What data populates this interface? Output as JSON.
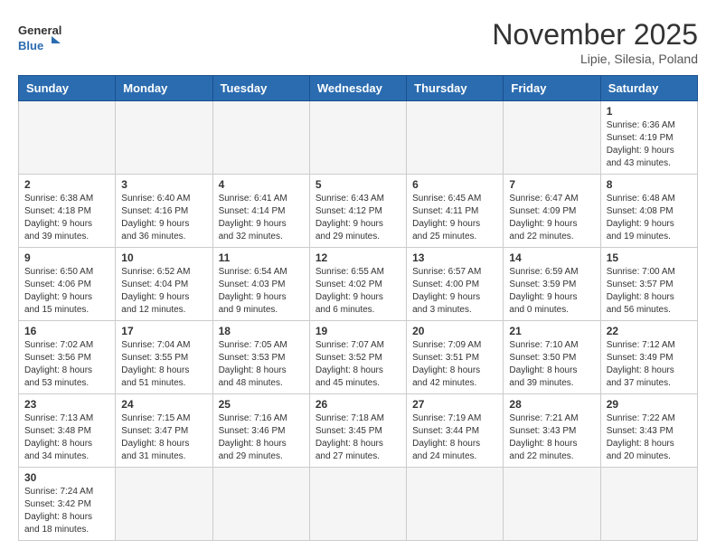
{
  "logo": {
    "text_general": "General",
    "text_blue": "Blue"
  },
  "title": "November 2025",
  "location": "Lipie, Silesia, Poland",
  "weekdays": [
    "Sunday",
    "Monday",
    "Tuesday",
    "Wednesday",
    "Thursday",
    "Friday",
    "Saturday"
  ],
  "weeks": [
    [
      {
        "day": "",
        "info": ""
      },
      {
        "day": "",
        "info": ""
      },
      {
        "day": "",
        "info": ""
      },
      {
        "day": "",
        "info": ""
      },
      {
        "day": "",
        "info": ""
      },
      {
        "day": "",
        "info": ""
      },
      {
        "day": "1",
        "info": "Sunrise: 6:36 AM\nSunset: 4:19 PM\nDaylight: 9 hours and 43 minutes."
      }
    ],
    [
      {
        "day": "2",
        "info": "Sunrise: 6:38 AM\nSunset: 4:18 PM\nDaylight: 9 hours and 39 minutes."
      },
      {
        "day": "3",
        "info": "Sunrise: 6:40 AM\nSunset: 4:16 PM\nDaylight: 9 hours and 36 minutes."
      },
      {
        "day": "4",
        "info": "Sunrise: 6:41 AM\nSunset: 4:14 PM\nDaylight: 9 hours and 32 minutes."
      },
      {
        "day": "5",
        "info": "Sunrise: 6:43 AM\nSunset: 4:12 PM\nDaylight: 9 hours and 29 minutes."
      },
      {
        "day": "6",
        "info": "Sunrise: 6:45 AM\nSunset: 4:11 PM\nDaylight: 9 hours and 25 minutes."
      },
      {
        "day": "7",
        "info": "Sunrise: 6:47 AM\nSunset: 4:09 PM\nDaylight: 9 hours and 22 minutes."
      },
      {
        "day": "8",
        "info": "Sunrise: 6:48 AM\nSunset: 4:08 PM\nDaylight: 9 hours and 19 minutes."
      }
    ],
    [
      {
        "day": "9",
        "info": "Sunrise: 6:50 AM\nSunset: 4:06 PM\nDaylight: 9 hours and 15 minutes."
      },
      {
        "day": "10",
        "info": "Sunrise: 6:52 AM\nSunset: 4:04 PM\nDaylight: 9 hours and 12 minutes."
      },
      {
        "day": "11",
        "info": "Sunrise: 6:54 AM\nSunset: 4:03 PM\nDaylight: 9 hours and 9 minutes."
      },
      {
        "day": "12",
        "info": "Sunrise: 6:55 AM\nSunset: 4:02 PM\nDaylight: 9 hours and 6 minutes."
      },
      {
        "day": "13",
        "info": "Sunrise: 6:57 AM\nSunset: 4:00 PM\nDaylight: 9 hours and 3 minutes."
      },
      {
        "day": "14",
        "info": "Sunrise: 6:59 AM\nSunset: 3:59 PM\nDaylight: 9 hours and 0 minutes."
      },
      {
        "day": "15",
        "info": "Sunrise: 7:00 AM\nSunset: 3:57 PM\nDaylight: 8 hours and 56 minutes."
      }
    ],
    [
      {
        "day": "16",
        "info": "Sunrise: 7:02 AM\nSunset: 3:56 PM\nDaylight: 8 hours and 53 minutes."
      },
      {
        "day": "17",
        "info": "Sunrise: 7:04 AM\nSunset: 3:55 PM\nDaylight: 8 hours and 51 minutes."
      },
      {
        "day": "18",
        "info": "Sunrise: 7:05 AM\nSunset: 3:53 PM\nDaylight: 8 hours and 48 minutes."
      },
      {
        "day": "19",
        "info": "Sunrise: 7:07 AM\nSunset: 3:52 PM\nDaylight: 8 hours and 45 minutes."
      },
      {
        "day": "20",
        "info": "Sunrise: 7:09 AM\nSunset: 3:51 PM\nDaylight: 8 hours and 42 minutes."
      },
      {
        "day": "21",
        "info": "Sunrise: 7:10 AM\nSunset: 3:50 PM\nDaylight: 8 hours and 39 minutes."
      },
      {
        "day": "22",
        "info": "Sunrise: 7:12 AM\nSunset: 3:49 PM\nDaylight: 8 hours and 37 minutes."
      }
    ],
    [
      {
        "day": "23",
        "info": "Sunrise: 7:13 AM\nSunset: 3:48 PM\nDaylight: 8 hours and 34 minutes."
      },
      {
        "day": "24",
        "info": "Sunrise: 7:15 AM\nSunset: 3:47 PM\nDaylight: 8 hours and 31 minutes."
      },
      {
        "day": "25",
        "info": "Sunrise: 7:16 AM\nSunset: 3:46 PM\nDaylight: 8 hours and 29 minutes."
      },
      {
        "day": "26",
        "info": "Sunrise: 7:18 AM\nSunset: 3:45 PM\nDaylight: 8 hours and 27 minutes."
      },
      {
        "day": "27",
        "info": "Sunrise: 7:19 AM\nSunset: 3:44 PM\nDaylight: 8 hours and 24 minutes."
      },
      {
        "day": "28",
        "info": "Sunrise: 7:21 AM\nSunset: 3:43 PM\nDaylight: 8 hours and 22 minutes."
      },
      {
        "day": "29",
        "info": "Sunrise: 7:22 AM\nSunset: 3:43 PM\nDaylight: 8 hours and 20 minutes."
      }
    ],
    [
      {
        "day": "30",
        "info": "Sunrise: 7:24 AM\nSunset: 3:42 PM\nDaylight: 8 hours and 18 minutes."
      },
      {
        "day": "",
        "info": ""
      },
      {
        "day": "",
        "info": ""
      },
      {
        "day": "",
        "info": ""
      },
      {
        "day": "",
        "info": ""
      },
      {
        "day": "",
        "info": ""
      },
      {
        "day": "",
        "info": ""
      }
    ]
  ]
}
